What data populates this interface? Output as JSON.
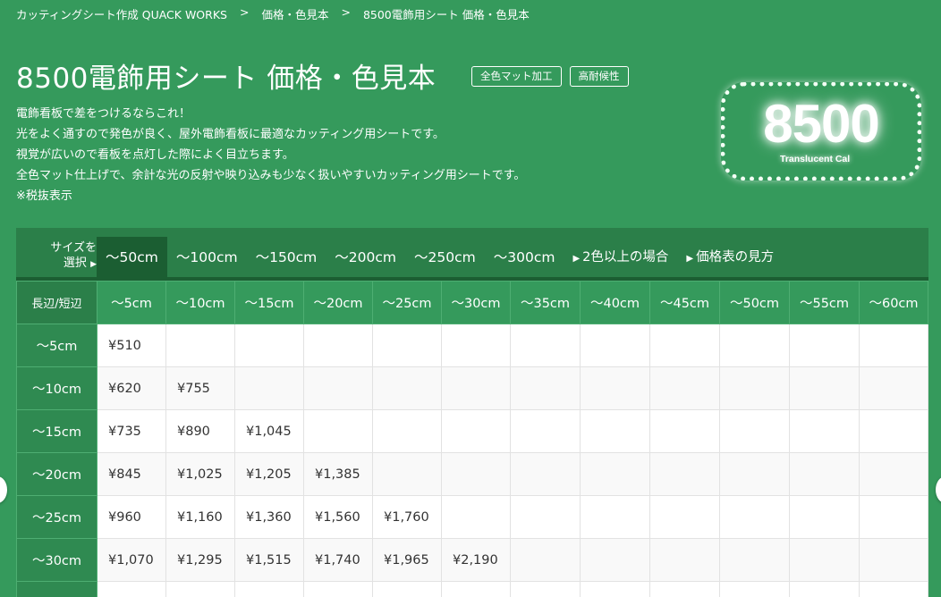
{
  "breadcrumb": [
    "カッティングシート作成 QUACK WORKS",
    "価格・色見本",
    "8500電飾用シート 価格・色見本"
  ],
  "breadcrumb_separator": ">",
  "title": "8500電飾用シート 価格・色見本",
  "badges": [
    "全色マット加工",
    "高耐候性"
  ],
  "description": [
    "電飾看板で差をつけるならこれ！",
    "光をよく通すので発色が良く、屋外電飾看板に最適なカッティング用シートです。",
    "視覚が広いので看板を点灯した際によく目立ちます。",
    "全色マット仕上げで、余計な光の反射や映り込みも少なく扱いやすいカッティング用シートです。",
    "※税抜表示"
  ],
  "logo": {
    "number": "8500",
    "subtitle": "Translucent Cal"
  },
  "size_selector": {
    "label_line1": "サイズを",
    "label_line2": "選択",
    "tabs": [
      "〜50cm",
      "〜100cm",
      "〜150cm",
      "〜200cm",
      "〜250cm",
      "〜300cm"
    ],
    "active_tab": 0,
    "links": [
      "2色以上の場合",
      "価格表の見方"
    ]
  },
  "price_table": {
    "corner": "長辺/短辺",
    "columns": [
      "〜5cm",
      "〜10cm",
      "〜15cm",
      "〜20cm",
      "〜25cm",
      "〜30cm",
      "〜35cm",
      "〜40cm",
      "〜45cm",
      "〜50cm",
      "〜55cm",
      "〜60cm"
    ],
    "rows": [
      {
        "label": "〜5cm",
        "cells": [
          "¥510",
          "",
          "",
          "",
          "",
          "",
          "",
          "",
          "",
          "",
          "",
          ""
        ]
      },
      {
        "label": "〜10cm",
        "cells": [
          "¥620",
          "¥755",
          "",
          "",
          "",
          "",
          "",
          "",
          "",
          "",
          "",
          ""
        ]
      },
      {
        "label": "〜15cm",
        "cells": [
          "¥735",
          "¥890",
          "¥1,045",
          "",
          "",
          "",
          "",
          "",
          "",
          "",
          "",
          ""
        ]
      },
      {
        "label": "〜20cm",
        "cells": [
          "¥845",
          "¥1,025",
          "¥1,205",
          "¥1,385",
          "",
          "",
          "",
          "",
          "",
          "",
          "",
          ""
        ]
      },
      {
        "label": "〜25cm",
        "cells": [
          "¥960",
          "¥1,160",
          "¥1,360",
          "¥1,560",
          "¥1,760",
          "",
          "",
          "",
          "",
          "",
          "",
          ""
        ]
      },
      {
        "label": "〜30cm",
        "cells": [
          "¥1,070",
          "¥1,295",
          "¥1,515",
          "¥1,740",
          "¥1,965",
          "¥2,190",
          "",
          "",
          "",
          "",
          "",
          ""
        ]
      },
      {
        "label": "",
        "cells": [
          "",
          "",
          "",
          "",
          "",
          "",
          "",
          "",
          "",
          "",
          "",
          ""
        ]
      }
    ]
  },
  "colors": {
    "background": "#359a5c",
    "panel": "#2b7f49",
    "active_tab": "#1b5e32"
  }
}
